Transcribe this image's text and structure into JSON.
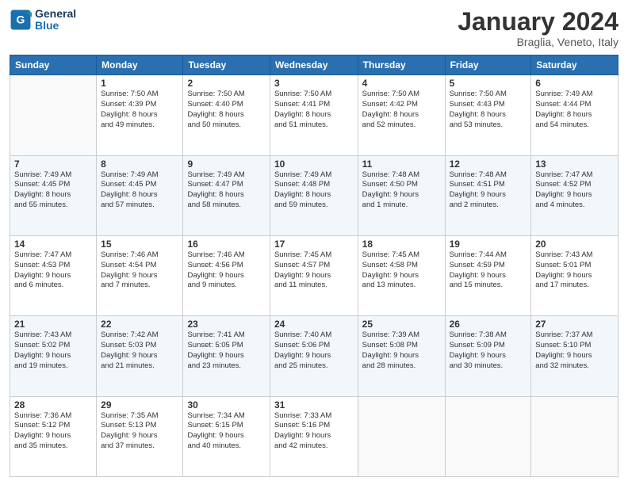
{
  "logo": {
    "line1": "General",
    "line2": "Blue"
  },
  "header": {
    "title": "January 2024",
    "subtitle": "Braglia, Veneto, Italy"
  },
  "weekdays": [
    "Sunday",
    "Monday",
    "Tuesday",
    "Wednesday",
    "Thursday",
    "Friday",
    "Saturday"
  ],
  "weeks": [
    [
      {
        "day": "",
        "info": ""
      },
      {
        "day": "1",
        "info": "Sunrise: 7:50 AM\nSunset: 4:39 PM\nDaylight: 8 hours\nand 49 minutes."
      },
      {
        "day": "2",
        "info": "Sunrise: 7:50 AM\nSunset: 4:40 PM\nDaylight: 8 hours\nand 50 minutes."
      },
      {
        "day": "3",
        "info": "Sunrise: 7:50 AM\nSunset: 4:41 PM\nDaylight: 8 hours\nand 51 minutes."
      },
      {
        "day": "4",
        "info": "Sunrise: 7:50 AM\nSunset: 4:42 PM\nDaylight: 8 hours\nand 52 minutes."
      },
      {
        "day": "5",
        "info": "Sunrise: 7:50 AM\nSunset: 4:43 PM\nDaylight: 8 hours\nand 53 minutes."
      },
      {
        "day": "6",
        "info": "Sunrise: 7:49 AM\nSunset: 4:44 PM\nDaylight: 8 hours\nand 54 minutes."
      }
    ],
    [
      {
        "day": "7",
        "info": ""
      },
      {
        "day": "8",
        "info": "Sunrise: 7:49 AM\nSunset: 4:45 PM\nDaylight: 8 hours\nand 57 minutes."
      },
      {
        "day": "9",
        "info": "Sunrise: 7:49 AM\nSunset: 4:47 PM\nDaylight: 8 hours\nand 58 minutes."
      },
      {
        "day": "10",
        "info": "Sunrise: 7:49 AM\nSunset: 4:48 PM\nDaylight: 8 hours\nand 59 minutes."
      },
      {
        "day": "11",
        "info": "Sunrise: 7:48 AM\nSunset: 4:50 PM\nDaylight: 9 hours\nand 1 minute."
      },
      {
        "day": "12",
        "info": "Sunrise: 7:48 AM\nSunset: 4:51 PM\nDaylight: 9 hours\nand 2 minutes."
      },
      {
        "day": "13",
        "info": "Sunrise: 7:47 AM\nSunset: 4:52 PM\nDaylight: 9 hours\nand 4 minutes."
      }
    ],
    [
      {
        "day": "14",
        "info": "Sunrise: 7:47 AM\nSunset: 4:53 PM\nDaylight: 9 hours\nand 6 minutes."
      },
      {
        "day": "15",
        "info": "Sunrise: 7:46 AM\nSunset: 4:54 PM\nDaylight: 9 hours\nand 7 minutes."
      },
      {
        "day": "16",
        "info": "Sunrise: 7:46 AM\nSunset: 4:56 PM\nDaylight: 9 hours\nand 9 minutes."
      },
      {
        "day": "17",
        "info": "Sunrise: 7:45 AM\nSunset: 4:57 PM\nDaylight: 9 hours\nand 11 minutes."
      },
      {
        "day": "18",
        "info": "Sunrise: 7:45 AM\nSunset: 4:58 PM\nDaylight: 9 hours\nand 13 minutes."
      },
      {
        "day": "19",
        "info": "Sunrise: 7:44 AM\nSunset: 4:59 PM\nDaylight: 9 hours\nand 15 minutes."
      },
      {
        "day": "20",
        "info": "Sunrise: 7:43 AM\nSunset: 5:01 PM\nDaylight: 9 hours\nand 17 minutes."
      }
    ],
    [
      {
        "day": "21",
        "info": "Sunrise: 7:43 AM\nSunset: 5:02 PM\nDaylight: 9 hours\nand 19 minutes."
      },
      {
        "day": "22",
        "info": "Sunrise: 7:42 AM\nSunset: 5:03 PM\nDaylight: 9 hours\nand 21 minutes."
      },
      {
        "day": "23",
        "info": "Sunrise: 7:41 AM\nSunset: 5:05 PM\nDaylight: 9 hours\nand 23 minutes."
      },
      {
        "day": "24",
        "info": "Sunrise: 7:40 AM\nSunset: 5:06 PM\nDaylight: 9 hours\nand 25 minutes."
      },
      {
        "day": "25",
        "info": "Sunrise: 7:39 AM\nSunset: 5:08 PM\nDaylight: 9 hours\nand 28 minutes."
      },
      {
        "day": "26",
        "info": "Sunrise: 7:38 AM\nSunset: 5:09 PM\nDaylight: 9 hours\nand 30 minutes."
      },
      {
        "day": "27",
        "info": "Sunrise: 7:37 AM\nSunset: 5:10 PM\nDaylight: 9 hours\nand 32 minutes."
      }
    ],
    [
      {
        "day": "28",
        "info": "Sunrise: 7:36 AM\nSunset: 5:12 PM\nDaylight: 9 hours\nand 35 minutes."
      },
      {
        "day": "29",
        "info": "Sunrise: 7:35 AM\nSunset: 5:13 PM\nDaylight: 9 hours\nand 37 minutes."
      },
      {
        "day": "30",
        "info": "Sunrise: 7:34 AM\nSunset: 5:15 PM\nDaylight: 9 hours\nand 40 minutes."
      },
      {
        "day": "31",
        "info": "Sunrise: 7:33 AM\nSunset: 5:16 PM\nDaylight: 9 hours\nand 42 minutes."
      },
      {
        "day": "",
        "info": ""
      },
      {
        "day": "",
        "info": ""
      },
      {
        "day": "",
        "info": ""
      }
    ]
  ],
  "week1_sunday_info": "Sunrise: 7:49 AM\nSunset: 4:45 PM\nDaylight: 8 hours\nand 55 minutes."
}
